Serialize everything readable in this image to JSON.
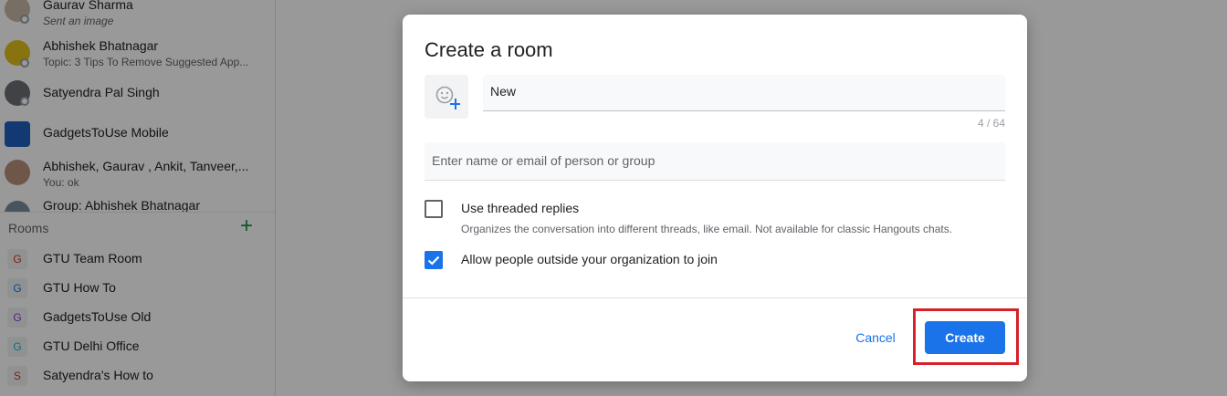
{
  "conversations": [
    {
      "name": "Gaurav Sharma",
      "sub": "Sent an image"
    },
    {
      "name": "Abhishek Bhatnagar",
      "sub": "Topic: 3 Tips To Remove Suggested App..."
    },
    {
      "name": "Satyendra Pal Singh",
      "sub": ""
    },
    {
      "name": "GadgetsToUse Mobile",
      "sub": ""
    },
    {
      "name": "Abhishek, Gaurav , Ankit, Tanveer,...",
      "sub": "You: ok"
    },
    {
      "name": "Group: Abhishek Bhatnagar",
      "sub": ""
    }
  ],
  "rooms_section": {
    "label": "Rooms",
    "add_icon": "plus-icon"
  },
  "rooms": [
    {
      "initial": "G",
      "name": "GTU Team Room",
      "color": "#d93025"
    },
    {
      "initial": "G",
      "name": "GTU How To",
      "color": "#1a73e8"
    },
    {
      "initial": "G",
      "name": "GadgetsToUse Old",
      "color": "#9334e6"
    },
    {
      "initial": "G",
      "name": "GTU Delhi Office",
      "color": "#12b5cb"
    },
    {
      "initial": "S",
      "name": "Satyendra's How to",
      "color": "#d93025"
    }
  ],
  "dialog": {
    "title": "Create a room",
    "room_name_value": "New",
    "char_counter": "4 / 64",
    "people_placeholder": "Enter name or email of person or group",
    "threaded_label": "Use threaded replies",
    "threaded_desc": "Organizes the conversation into different threads, like email. Not available for classic Hangouts chats.",
    "threaded_checked": false,
    "external_label": "Allow people outside your organization to join",
    "external_checked": true,
    "cancel_label": "Cancel",
    "create_label": "Create"
  },
  "colors": {
    "accent": "#1a73e8",
    "highlight": "#d8202a",
    "add": "#1e8e3e"
  }
}
